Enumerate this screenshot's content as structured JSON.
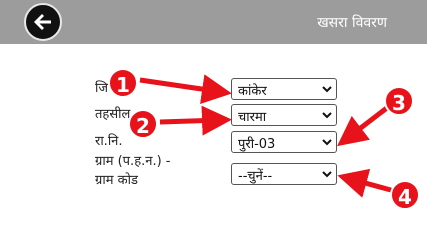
{
  "header": {
    "title": "खसरा विवरण",
    "back_icon": "back-arrow-icon",
    "background": "#9c9c9c"
  },
  "form": {
    "district": {
      "label": "जि",
      "value": "कांकेर"
    },
    "tehsil": {
      "label": "तहसील",
      "value": "चारमा"
    },
    "ri": {
      "label": "रा.नि.",
      "value": "पुरी-03"
    },
    "village": {
      "label_line1": "ग्राम (प.ह.न.) -",
      "label_line2": "ग्राम कोड",
      "value": "--चुनें--"
    }
  },
  "annotations": {
    "color": "#e8121b",
    "markers": [
      {
        "number": "1"
      },
      {
        "number": "2"
      },
      {
        "number": "3"
      },
      {
        "number": "4"
      }
    ]
  }
}
